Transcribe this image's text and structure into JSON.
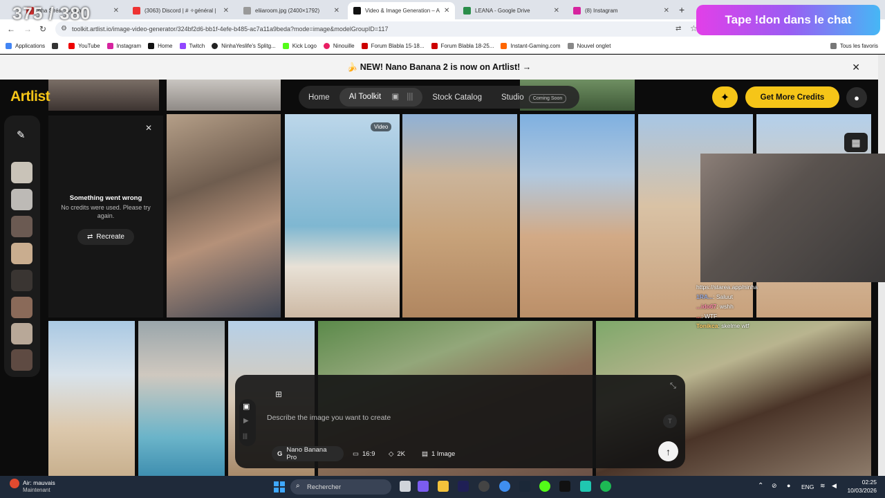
{
  "overlay": {
    "view_counter": "375 / 380",
    "donation_banner": "Tape !don dans le chat"
  },
  "browser": {
    "tabs": [
      {
        "label": "nha S'réa... ve on",
        "color": "#d33"
      },
      {
        "label": "(3063) Discord | # ✧général |",
        "color": "#e33"
      },
      {
        "label": "eliiaroom.jpg (2400×1792)",
        "color": "#999"
      },
      {
        "label": "Video & Image Generation – A",
        "color": "#111"
      },
      {
        "label": "LEANA - Google Drive",
        "color": "#2a8d4a"
      },
      {
        "label": "(8) Instagram",
        "color": "#d6249f"
      }
    ],
    "url": "toolkit.artlist.io/image-video-generator/324bf2d6-bb1f-4efe-b485-ac7a11a9beda?mode=image&modelGroupID=117",
    "bookmarks": [
      {
        "label": "Applications",
        "color": "#4285f4"
      },
      {
        "label": "YouTube",
        "color": "#e00"
      },
      {
        "label": "Instagram",
        "color": "#d6249f"
      },
      {
        "label": "Home",
        "color": "#111"
      },
      {
        "label": "Twitch",
        "color": "#9146ff"
      },
      {
        "label": "NinhaYeslife's Splitg...",
        "color": "#222"
      },
      {
        "label": "Kick Logo",
        "color": "#53fc18"
      },
      {
        "label": "Ninouille",
        "color": "#e91e63"
      },
      {
        "label": "Forum Blabla 15-18...",
        "color": "#c00"
      },
      {
        "label": "Forum Blabla 18-25...",
        "color": "#c00"
      },
      {
        "label": "Instant-Gaming.com",
        "color": "#f60"
      },
      {
        "label": "Nouvel onglet",
        "color": "#888"
      }
    ],
    "all_bookmarks": "Tous les favoris"
  },
  "page": {
    "banner": "🍌 NEW! Nano Banana 2 is now on Artlist! →",
    "logo": "Artlist",
    "nav": {
      "home": "Home",
      "ai_toolkit": "AI Toolkit",
      "stock_catalog": "Stock Catalog",
      "studio": "Studio",
      "coming_soon": "Coming Soon"
    },
    "get_credits": "Get More Credits",
    "error": {
      "title": "Something went wrong",
      "subtitle": "No credits were used. Please try again.",
      "recreate": "Recreate"
    },
    "video_badge": "Video",
    "composer": {
      "placeholder": "Describe the image you want to create",
      "model": "Nano Banana Pro",
      "ratio": "16:9",
      "resolution": "2K",
      "count": "1 Image"
    }
  },
  "stream_chat": {
    "link": "https://starea.app/ninha",
    "lines": [
      {
        "name": "1RA...",
        "msg": "Saluut"
      },
      {
        "name": "...ido67",
        "msg": "wshh"
      },
      {
        "name": "...",
        "msg": "WTF"
      },
      {
        "name": "Tonikca",
        "msg": "skelme wtf"
      }
    ]
  },
  "taskbar": {
    "weather": "Air: mauvais",
    "weather_sub": "Maintenant",
    "search": "Rechercher",
    "lang": "ENG",
    "time": "02:25",
    "date": "10/03/2026"
  }
}
